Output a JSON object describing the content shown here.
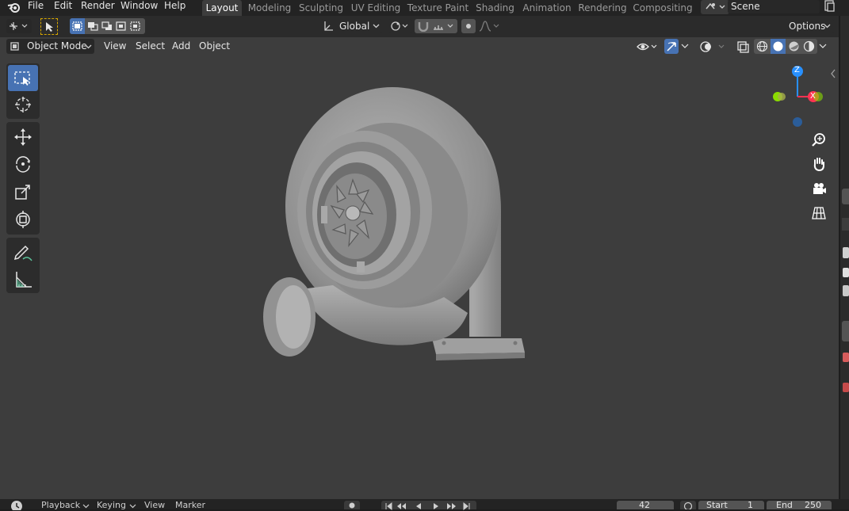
{
  "menu": {
    "file": "File",
    "edit": "Edit",
    "render": "Render",
    "window": "Window",
    "help": "Help"
  },
  "workspaces": [
    {
      "label": "Layout",
      "active": true
    },
    {
      "label": "Modeling",
      "active": false
    },
    {
      "label": "Sculpting",
      "active": false
    },
    {
      "label": "UV Editing",
      "active": false
    },
    {
      "label": "Texture Paint",
      "active": false
    },
    {
      "label": "Shading",
      "active": false
    },
    {
      "label": "Animation",
      "active": false
    },
    {
      "label": "Rendering",
      "active": false
    },
    {
      "label": "Compositing",
      "active": false
    }
  ],
  "scene": {
    "label": "Scene"
  },
  "header": {
    "orientation": "Global",
    "options": "Options"
  },
  "viewport_header": {
    "mode": "Object Mode",
    "view": "View",
    "select": "Select",
    "add": "Add",
    "object": "Object"
  },
  "gizmo": {
    "z": "Z",
    "x": "X"
  },
  "timeline": {
    "playback": "Playback",
    "keying": "Keying",
    "view": "View",
    "marker": "Marker",
    "current_frame": "42",
    "start_label": "Start",
    "start_value": "1",
    "end_label": "End",
    "end_value": "250"
  },
  "colors": {
    "accent": "#4772b3",
    "axis_x": "#ff3352",
    "axis_y": "#8bdc00",
    "axis_z": "#2890ff"
  }
}
